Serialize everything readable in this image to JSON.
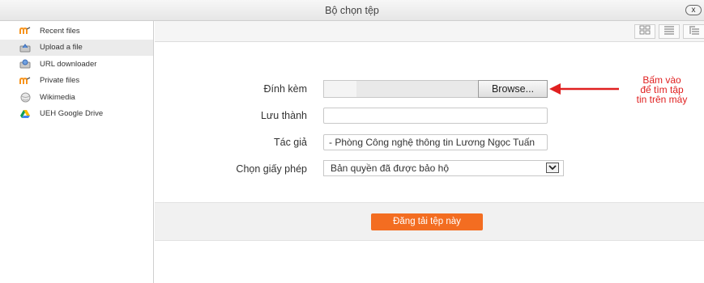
{
  "dialog": {
    "title": "Bộ chọn tệp",
    "close_label": "x"
  },
  "sidebar": {
    "items": [
      {
        "label": "Recent files",
        "icon": "moodle-icon"
      },
      {
        "label": "Upload a file",
        "icon": "upload-icon",
        "active": true
      },
      {
        "label": "URL downloader",
        "icon": "url-downloader-icon"
      },
      {
        "label": "Private files",
        "icon": "moodle-icon"
      },
      {
        "label": "Wikimedia",
        "icon": "wikimedia-icon"
      },
      {
        "label": "UEH Google Drive",
        "icon": "google-drive-icon"
      }
    ]
  },
  "toolbar": {
    "views": [
      "grid-view-icon",
      "list-view-icon",
      "tree-view-icon"
    ]
  },
  "form": {
    "attachment_label": "Đính kèm",
    "browse_label": "Browse...",
    "save_as_label": "Lưu thành",
    "save_as_value": "",
    "author_label": "Tác giả",
    "author_value": "- Phòng Công nghệ thông tin Lương Ngọc Tuấn",
    "license_label": "Chọn giấy phép",
    "license_value": "Bản quyền đã được bảo hộ",
    "upload_button": "Đăng tải tệp này"
  },
  "annotation": {
    "lines": [
      "Bấm vào",
      "để tìm tập",
      "tin trên máy"
    ],
    "color": "#e02020"
  },
  "colors": {
    "accent": "#f36d21"
  }
}
